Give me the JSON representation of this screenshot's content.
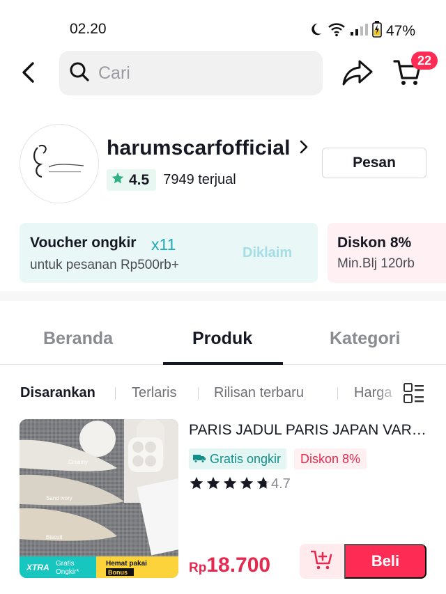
{
  "status_bar": {
    "time": "02.20",
    "battery_pct": "47%"
  },
  "nav": {
    "search_placeholder": "Cari",
    "cart_count": "22"
  },
  "shop": {
    "name": "harumscarfofficial",
    "rating": "4.5",
    "sold": "7949 terjual",
    "message_label": "Pesan"
  },
  "vouchers": [
    {
      "title": "Voucher ongkir",
      "multiplier": "x11",
      "subtitle": "untuk pesanan Rp500rb+",
      "status": "Diklaim"
    },
    {
      "title": "Diskon 8%",
      "subtitle": "Min.Blj 120rb"
    }
  ],
  "tabs": [
    "Beranda",
    "Produk",
    "Kategori"
  ],
  "active_tab": "Produk",
  "filters": [
    "Disarankan",
    "Terlaris",
    "Rilisan terbaru",
    "Harga"
  ],
  "active_filter": "Disarankan",
  "product": {
    "title": "PARIS JADUL PARIS JAPAN VARIASI",
    "free_shipping": "Gratis ongkir",
    "discount": "Diskon 8%",
    "rating": "4.7",
    "rating_value": 4.7,
    "currency": "Rp",
    "price": "18.700",
    "buy_label": "Beli",
    "image_labels": [
      "Creamy",
      "Sand ivory",
      "Biscuit"
    ],
    "image_banner": {
      "xtra": "XTRA",
      "free_line1": "Gratis",
      "free_line2": "Ongkir*",
      "promo_line1": "Hemat pakai",
      "promo_line2": "Bonus"
    }
  },
  "colors": {
    "accent": "#fe2c55",
    "teal": "#21a9b8",
    "rating_star": "#2fb283"
  }
}
